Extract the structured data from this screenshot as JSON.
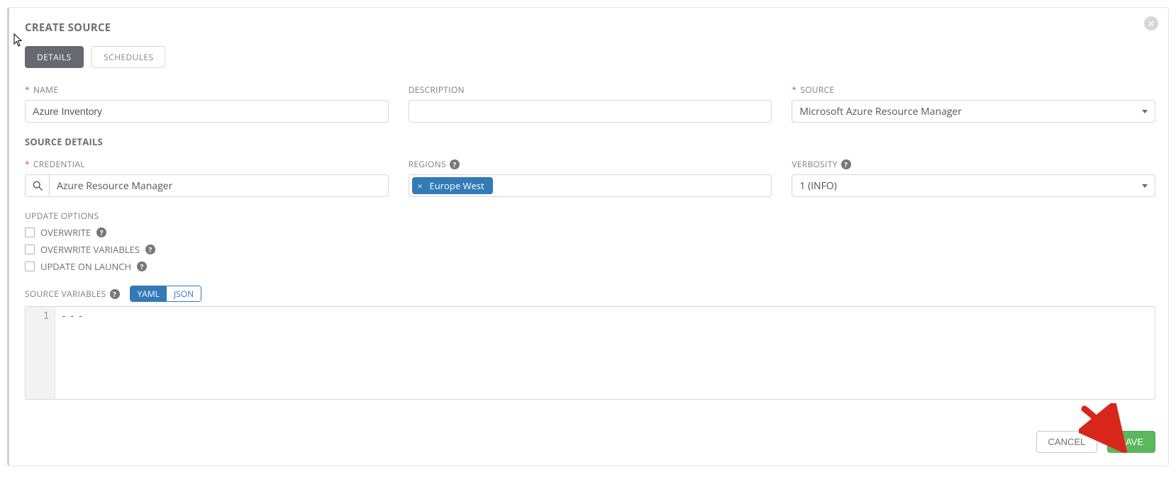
{
  "header": {
    "title": "CREATE SOURCE"
  },
  "tabs": [
    {
      "label": "DETAILS",
      "active": true
    },
    {
      "label": "SCHEDULES",
      "active": false
    }
  ],
  "fields": {
    "name_label": "NAME",
    "name_value": "Azure Inventory",
    "description_label": "DESCRIPTION",
    "description_value": "",
    "source_label": "SOURCE",
    "source_value": "Microsoft Azure Resource Manager",
    "credential_label": "CREDENTIAL",
    "credential_value": "Azure Resource Manager",
    "regions_label": "REGIONS",
    "regions_tag": "Europe West",
    "verbosity_label": "VERBOSITY",
    "verbosity_value": "1 (INFO)"
  },
  "sections": {
    "source_details": "SOURCE DETAILS",
    "update_options": "UPDATE OPTIONS",
    "source_variables": "SOURCE VARIABLES"
  },
  "options": {
    "overwrite": "OVERWRITE",
    "overwrite_variables": "OVERWRITE VARIABLES",
    "update_on_launch": "UPDATE ON LAUNCH"
  },
  "toggle": {
    "yaml": "YAML",
    "json": "JSON"
  },
  "editor": {
    "line_number": "1",
    "content": "---"
  },
  "buttons": {
    "cancel": "CANCEL",
    "save": "SAVE"
  }
}
